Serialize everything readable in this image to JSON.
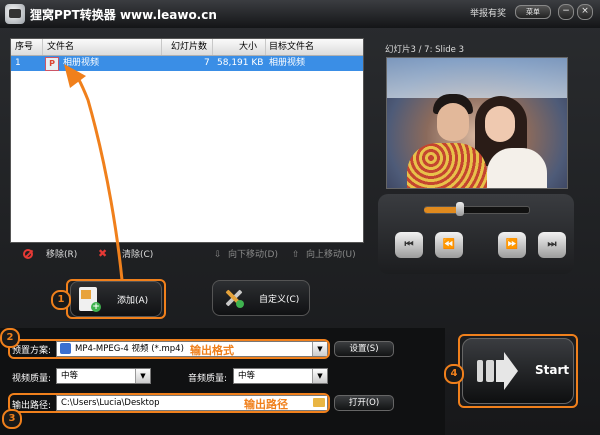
{
  "app": {
    "title": "狸窝PPT转换器 www.leawo.cn",
    "report_link": "举报有奖",
    "menu_label": "菜单",
    "minimize": "−",
    "close": "×"
  },
  "file_list": {
    "columns": [
      "序号",
      "文件名",
      "幻灯片数",
      "大小",
      "目标文件名"
    ],
    "rows": [
      {
        "index": "1",
        "name": "相册视频",
        "slides": "7",
        "size": "58,191 KB",
        "target": "相册视频"
      }
    ]
  },
  "list_toolbar": {
    "remove": "移除(R)",
    "clear": "清除(C)",
    "move_down": "向下移动(D)",
    "move_up": "向上移动(U)"
  },
  "buttons": {
    "add": "添加(A)",
    "custom": "自定义(C)"
  },
  "preview": {
    "slide_label": "幻灯片3 / 7: Slide 3",
    "seek_progress": 0.35
  },
  "player_buttons": [
    "⏮",
    "⏪",
    "⏩",
    "⏭"
  ],
  "settings": {
    "preset_label": "预置方案:",
    "preset_value": "MP4-MPEG-4 视频 (*.mp4)",
    "preset_button": "设置(S)",
    "video_quality_label": "视频质量:",
    "video_quality_value": "中等",
    "audio_quality_label": "音频质量:",
    "audio_quality_value": "中等",
    "output_label": "输出路径:",
    "output_value": "C:\\Users\\Lucia\\Desktop",
    "open_button": "打开(O)",
    "start_button": "Start"
  },
  "annotations": {
    "num1": "1",
    "num2": "2",
    "num3": "3",
    "num4": "4",
    "format_note": "输出格式",
    "path_note": "输出路径",
    "color": "#f0801c"
  },
  "icons": {
    "remove": "no-entry-icon",
    "clear": "delete-x-icon",
    "down": "down-arrow-icon",
    "up": "up-arrow-icon",
    "folder": "folder-icon",
    "preset_format": "video-format-icon"
  }
}
